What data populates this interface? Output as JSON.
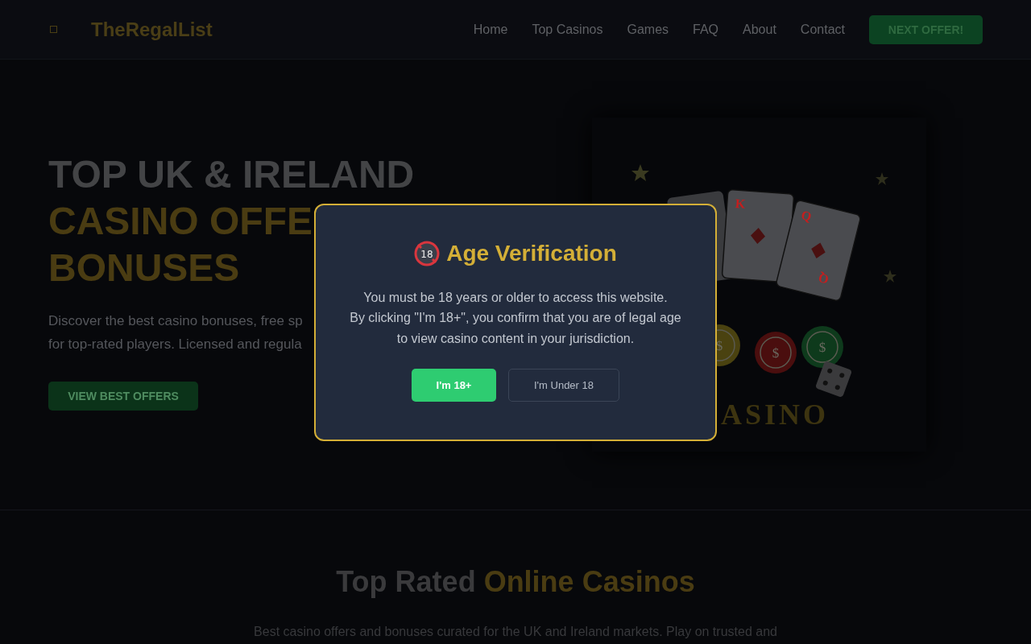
{
  "nav": {
    "logo": "TheRegalList",
    "links": [
      "Home",
      "Top Casinos",
      "Games",
      "FAQ",
      "About",
      "Contact"
    ],
    "cta": "NEXT OFFER!"
  },
  "hero": {
    "headline_lines": [
      {
        "text": "TOP UK & IRELAND",
        "kind": "plain"
      },
      {
        "text": "CASINO OFFE",
        "kind": "gold"
      },
      {
        "text": "BONUSES",
        "kind": "gold"
      }
    ],
    "description_lines": [
      "Discover the best casino bonuses, free sp",
      "for top-rated players. Licensed and regula"
    ],
    "button": "VIEW BEST OFFERS",
    "art": {
      "cards": [
        {
          "top": "K"
        },
        {
          "top": "Q",
          "bottom": "Q"
        }
      ],
      "chips": [
        {
          "label": "$",
          "color": "#4a4210"
        },
        {
          "label": "$",
          "color": "#4a0e0e"
        },
        {
          "label": "$",
          "color": "#0e3a1c"
        }
      ],
      "sign": "ASINO"
    }
  },
  "section": {
    "title_plain": "Top Rated ",
    "title_highlight": "Online Casinos",
    "text": "Best casino offers and bonuses curated for the UK and Ireland markets. Play on trusted and"
  },
  "modal": {
    "icon_label": "18",
    "title": "Age Verification",
    "lines": [
      "You must be 18 years or older to access this website.",
      "By clicking \"I'm 18+\", you confirm that you are of legal age",
      "to view casino content in your jurisdiction."
    ],
    "confirm": "I'm 18+",
    "decline": "I'm Under 18"
  }
}
